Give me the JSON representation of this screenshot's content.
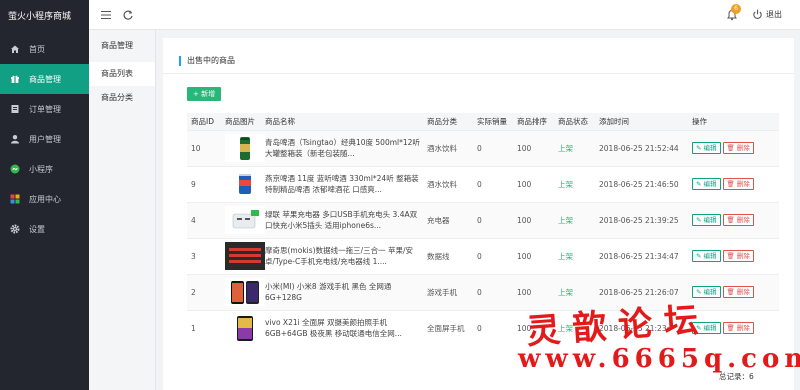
{
  "app": {
    "title": "萤火小程序商城"
  },
  "sidebar": {
    "items": [
      {
        "label": "首页",
        "icon": "home-icon",
        "active": false
      },
      {
        "label": "商品管理",
        "icon": "gift-icon",
        "active": true
      },
      {
        "label": "订单管理",
        "icon": "order-icon",
        "active": false
      },
      {
        "label": "用户管理",
        "icon": "user-icon",
        "active": false
      },
      {
        "label": "小程序",
        "icon": "miniapp-icon",
        "active": false
      },
      {
        "label": "应用中心",
        "icon": "apps-icon",
        "active": false
      },
      {
        "label": "设置",
        "icon": "gear-icon",
        "active": false
      }
    ]
  },
  "topbar": {
    "notification_count": "6",
    "logout_label": "退出"
  },
  "subnav": {
    "title": "商品管理",
    "items": [
      {
        "label": "商品列表",
        "active": true
      },
      {
        "label": "商品分类",
        "active": false
      }
    ]
  },
  "page": {
    "title": "出售中的商品",
    "add_label": "+ 新增",
    "total_label": "总记录：6"
  },
  "table": {
    "headers": [
      "商品ID",
      "商品图片",
      "商品名称",
      "商品分类",
      "实际销量",
      "商品排序",
      "商品状态",
      "添加时间",
      "操作"
    ],
    "edit_label": "编辑",
    "delete_label": "删除",
    "rows": [
      {
        "id": "10",
        "name": "青岛啤酒（Tsingtao）经典10度 500ml*12听 大罐整箱装（新老包装随...",
        "category": "酒水饮料",
        "sales": "0",
        "sort": "100",
        "status": "上架",
        "time": "2018-06-25 21:52:44",
        "thumb": "beer-green"
      },
      {
        "id": "9",
        "name": "燕京啤酒 11度 蓝听啤酒 330ml*24听 整箱装 特制精品啤酒 浓郁啤酒花 口感爽...",
        "category": "酒水饮料",
        "sales": "0",
        "sort": "100",
        "status": "上架",
        "time": "2018-06-25 21:46:50",
        "thumb": "beer-blue"
      },
      {
        "id": "4",
        "name": "绿联 苹果充电器 多口USB手机充电头 3.4A双口快充小米5插头 适用iphone6s...",
        "category": "充电器",
        "sales": "0",
        "sort": "100",
        "status": "上架",
        "time": "2018-06-25 21:39:25",
        "thumb": "charger"
      },
      {
        "id": "3",
        "name": "摩奇思(mokis)数据线一拖三/三合一 苹果/安卓/Type-C手机充电线/充电器线 1....",
        "category": "数据线",
        "sales": "0",
        "sort": "100",
        "status": "上架",
        "time": "2018-06-25 21:34:47",
        "thumb": "cables"
      },
      {
        "id": "2",
        "name": "小米(MI) 小米8 游戏手机 黑色 全网通 6G+128G",
        "category": "游戏手机",
        "sales": "0",
        "sort": "100",
        "status": "上架",
        "time": "2018-06-25 21:26:07",
        "thumb": "phone-mi"
      },
      {
        "id": "1",
        "name": "vivo X21i 全面屏 双摄美颜拍照手机 6GB+64GB 极夜黑 移动联通电信全网...",
        "category": "全面屏手机",
        "sales": "0",
        "sort": "100",
        "status": "上架",
        "time": "2018-06-25 21:23:",
        "thumb": "phone-vivo"
      }
    ]
  },
  "watermark": {
    "cn": "灵歆论坛",
    "url": "www.6665q.com"
  },
  "colors": {
    "sidebar_bg": "#23262e",
    "accent_teal": "#12a085",
    "add_green": "#28b779",
    "delete_red": "#d9534f",
    "title_bar_blue": "#1e9fff",
    "watermark_red": "#e21a1a"
  }
}
